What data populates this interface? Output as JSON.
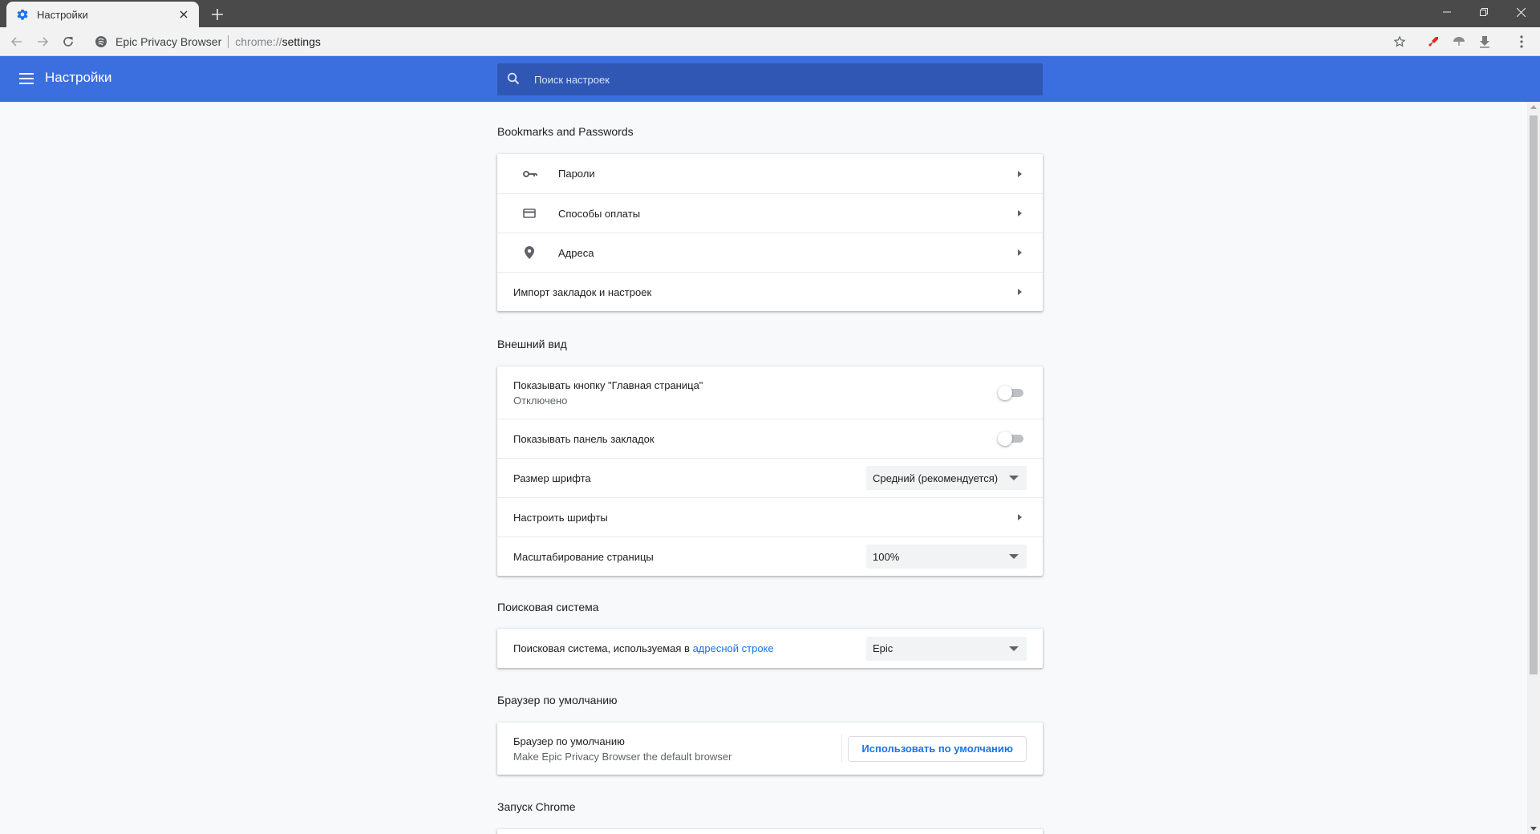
{
  "browser": {
    "tab": {
      "title": "Настройки",
      "icon": "gear-icon"
    },
    "omnibox": {
      "site_name": "Epic Privacy Browser",
      "url_scheme": "chrome://",
      "url_path": "settings"
    },
    "colors": {
      "header_blue": "#3b6fe0",
      "search_blue": "#2f57b3",
      "link_blue": "#1a73e8"
    }
  },
  "header": {
    "title": "Настройки",
    "search_placeholder": "Поиск настроек"
  },
  "sections": {
    "bookmarks": {
      "title": "Bookmarks and Passwords",
      "rows": [
        {
          "label": "Пароли",
          "icon": "key-icon"
        },
        {
          "label": "Способы оплаты",
          "icon": "credit-card-icon"
        },
        {
          "label": "Адреса",
          "icon": "location-pin-icon"
        },
        {
          "label": "Импорт закладок и настроек"
        }
      ]
    },
    "appearance": {
      "title": "Внешний вид",
      "home_button": {
        "label": "Показывать кнопку \"Главная страница\"",
        "sub": "Отключено",
        "enabled": false
      },
      "bookmarks_bar": {
        "label": "Показывать панель закладок",
        "enabled": false
      },
      "font_size": {
        "label": "Размер шрифта",
        "value": "Средний (рекомендуется)"
      },
      "customize_fonts": {
        "label": "Настроить шрифты"
      },
      "page_zoom": {
        "label": "Масштабирование страницы",
        "value": "100%"
      }
    },
    "search_engine": {
      "title": "Поисковая система",
      "label_prefix": "Поисковая система, используемая в ",
      "label_link": "адресной строке",
      "value": "Epic"
    },
    "default_browser": {
      "title": "Браузер по умолчанию",
      "label": "Браузер по умолчанию",
      "sub": "Make Epic Privacy Browser the default browser",
      "button": "Использовать по умолчанию"
    },
    "startup": {
      "title": "Запуск Chrome"
    }
  }
}
